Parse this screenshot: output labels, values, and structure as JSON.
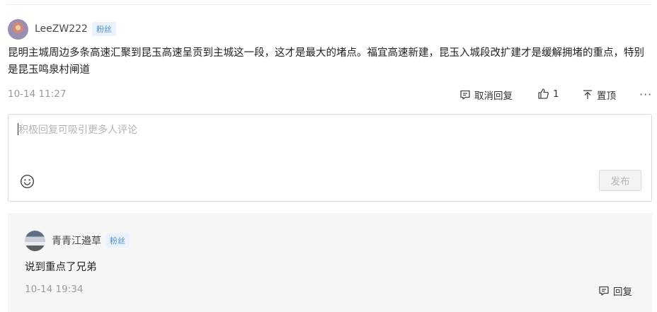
{
  "comment": {
    "username": "LeeZW222",
    "badge": "粉丝",
    "text": "昆明主城周边多条高速汇聚到昆玉高速呈贡到主城这一段，这才是最大的堵点。福宜高速新建，昆玉入城段改扩建才是缓解拥堵的重点，特别是昆玉鸣泉村闸道",
    "time": "10-14 11:27",
    "actions": {
      "cancel_reply": "取消回复",
      "like_count": "1",
      "pin": "置顶",
      "more": "···"
    }
  },
  "reply_box": {
    "placeholder": "积极回复可吸引更多人评论",
    "submit_label": "发布"
  },
  "sub_comment": {
    "username": "青青江邉草",
    "badge": "粉丝",
    "text": "说到重点了兄弟",
    "time": "10-14 19:34",
    "reply_label": "回复"
  },
  "icons": {
    "comment": "comment-icon",
    "like": "thumbs-up-icon",
    "pin": "pin-to-top-icon",
    "emoji": "smiley-icon"
  }
}
